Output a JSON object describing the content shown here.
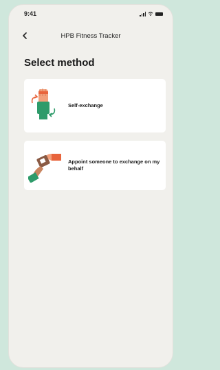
{
  "status_bar": {
    "time": "9:41"
  },
  "nav": {
    "title": "HPB Fitness Tracker",
    "back_icon": "chevron-left-icon"
  },
  "page": {
    "title": "Select method"
  },
  "options": [
    {
      "label": "Self-exchange",
      "icon": "self-exchange-illustration"
    },
    {
      "label": "Appoint someone to exchange on my behalf",
      "icon": "handover-illustration"
    }
  ],
  "colors": {
    "background": "#cfe7dc",
    "screen": "#f1f0ec",
    "card": "#ffffff",
    "accent_green": "#2e9b6a",
    "accent_orange": "#e8643c"
  }
}
